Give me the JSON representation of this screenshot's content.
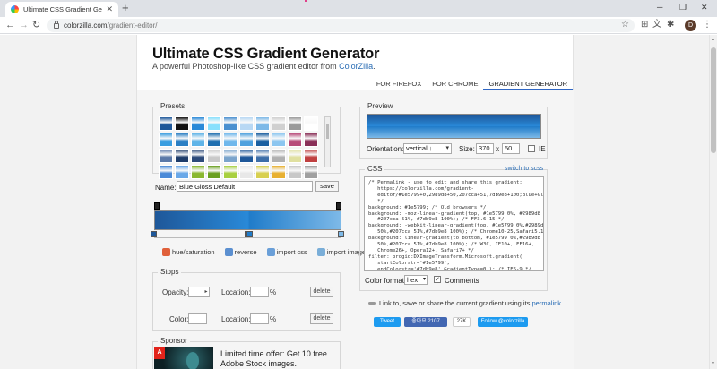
{
  "browser": {
    "tab_title": "Ultimate CSS Gradient Generat",
    "url_host": "colorzilla.com",
    "url_path": "/gradient-editor/",
    "profile_initial": "D"
  },
  "page": {
    "title": "Ultimate CSS Gradient Generator",
    "subtitle_prefix": "A powerful Photoshop-like CSS gradient editor from ",
    "subtitle_link": "ColorZilla",
    "subtitle_suffix": ".",
    "nav": [
      {
        "label": "FOR FIREFOX",
        "active": false
      },
      {
        "label": "FOR CHROME",
        "active": false
      },
      {
        "label": "GRADIENT GENERATOR",
        "active": true
      }
    ]
  },
  "presets": {
    "legend": "Presets",
    "swatches": [
      [
        "#1e5799",
        "#111111",
        "#2989d8",
        "#87e0fd",
        "#4a90d0",
        "#b8d8f4",
        "#7db9e8",
        "#d0d0d0",
        "#9a9a9a",
        "#ffffff"
      ],
      [
        "#3a9ee0",
        "#2b7fc4",
        "#5fb4e8",
        "#1f6fb0",
        "#70b8ec",
        "#4ea1de",
        "#1a5fa0",
        "#8cc6f0",
        "#b84b7a",
        "#8a3058"
      ],
      [
        "#5a78a8",
        "#1e3c6a",
        "#2c4a7a",
        "#c9c9c9",
        "#7aa4cc",
        "#1e5799",
        "#3d6ea8",
        "#b0b0b0",
        "#e0e0a0",
        "#c04040"
      ],
      [
        "#4a8ad8",
        "#6aa8e8",
        "#8ab830",
        "#6aa020",
        "#a8d040",
        "#e8e8e8",
        "#d8d050",
        "#e8b030",
        "#c8c8c8",
        "#a0a0a0"
      ]
    ]
  },
  "name_field": {
    "label": "Name:",
    "value": "Blue Gloss Default",
    "save": "save"
  },
  "gradient": {
    "stops": [
      {
        "color": "#1e5799",
        "position": 0
      },
      {
        "color": "#2989d8",
        "position": 50
      },
      {
        "color": "#207cca",
        "position": 51
      },
      {
        "color": "#7db9e8",
        "position": 100
      }
    ],
    "opacity_stops": [
      0,
      100
    ]
  },
  "tools": [
    {
      "label": "hue/saturation",
      "icon": "hue-icon",
      "color": "#e0603a"
    },
    {
      "label": "reverse",
      "icon": "reverse-icon",
      "color": "#5b8fd0"
    },
    {
      "label": "import css",
      "icon": "import-css-icon",
      "color": "#6a9fd8"
    },
    {
      "label": "import image",
      "icon": "import-image-icon",
      "color": "#7aaed8"
    }
  ],
  "stops_panel": {
    "legend": "Stops",
    "opacity_label": "Opacity:",
    "location_label": "Location:",
    "color_label": "Color:",
    "percent": "%",
    "delete": "delete"
  },
  "sponsor": {
    "legend": "Sponsor",
    "text": "Limited time offer: Get 10 free Adobe Stock images.",
    "logo_text": "A"
  },
  "preview": {
    "legend": "Preview",
    "orientation_label": "Orientation:",
    "orientation_value": "vertical ↓",
    "size_label": "Size:",
    "width": "370",
    "x": "x",
    "height": "50",
    "ie_label": "IE"
  },
  "css": {
    "legend": "CSS",
    "switch_link": "switch to scss",
    "code": "/* Permalink - use to edit and share this gradient:\n   https://colorzilla.com/gradient-\n   editor/#1e5799+0,2989d8+50,207cca+51,7db9e8+100;Blue+Gloss+Default\n   */\nbackground: #1e5799; /* Old browsers */\nbackground: -moz-linear-gradient(top, #1e5799 0%, #2989d8 50%,\n   #207cca 51%, #7db9e8 100%); /* FF3.6-15 */\nbackground: -webkit-linear-gradient(top, #1e5799 0%,#2989d8\n   50%,#207cca 51%,#7db9e8 100%); /* Chrome10-25,Safari5.1-6 */\nbackground: linear-gradient(to bottom, #1e5799 0%,#2989d8\n   50%,#207cca 51%,#7db9e8 100%); /* W3C, IE10+, FF16+,\n   Chrome26+, Opera12+, Safari7+ */\nfilter: progid:DXImageTransform.Microsoft.gradient(\n   startColorstr='#1e5799',\n   endColorstr='#7db9e8',GradientType=0 ); /* IE6-9 */",
    "format_label": "Color format:",
    "format_value": "hex",
    "comments_label": "Comments"
  },
  "share": {
    "text_prefix": "Link to, save or share the current gradient using its ",
    "link": "permalink",
    "text_suffix": ".",
    "tweet": "Tweet",
    "like": "좋아요 2107",
    "count": "27K",
    "follow": "Follow @colorzilla"
  }
}
